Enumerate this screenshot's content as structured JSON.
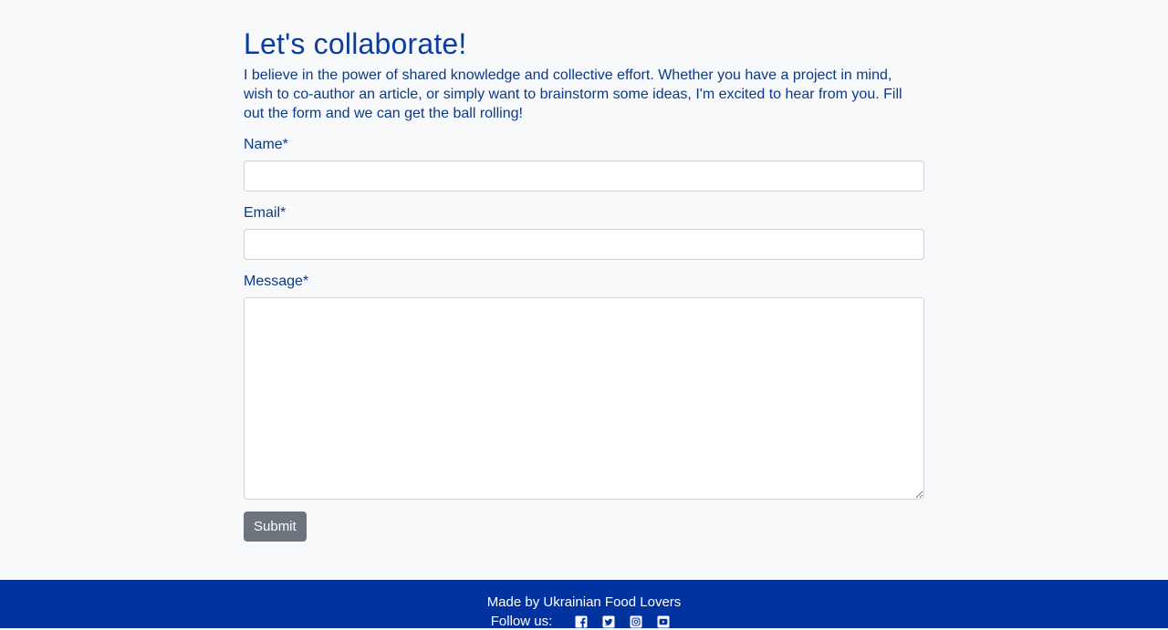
{
  "page": {
    "heading": "Let's collaborate!",
    "intro": "I believe in the power of shared knowledge and collective effort. Whether you have a project in mind, wish to co-author an article, or simply want to brainstorm some ideas, I'm excited to hear from you. Fill out the form and we can get the ball rolling!"
  },
  "form": {
    "name_label": "Name*",
    "name_value": "",
    "email_label": "Email*",
    "email_value": "",
    "message_label": "Message*",
    "message_value": "",
    "submit_label": "Submit"
  },
  "footer": {
    "made_by": "Made by Ukrainian Food Lovers",
    "follow_label": "Follow us:",
    "social": [
      "facebook-icon",
      "twitter-icon",
      "instagram-icon",
      "youtube-icon"
    ]
  },
  "colors": {
    "background": "#f8f9fa",
    "heading": "#0b3d9c",
    "text": "#0a3a8a",
    "footer_bg": "#0033a0",
    "button_bg": "#6c757d"
  }
}
